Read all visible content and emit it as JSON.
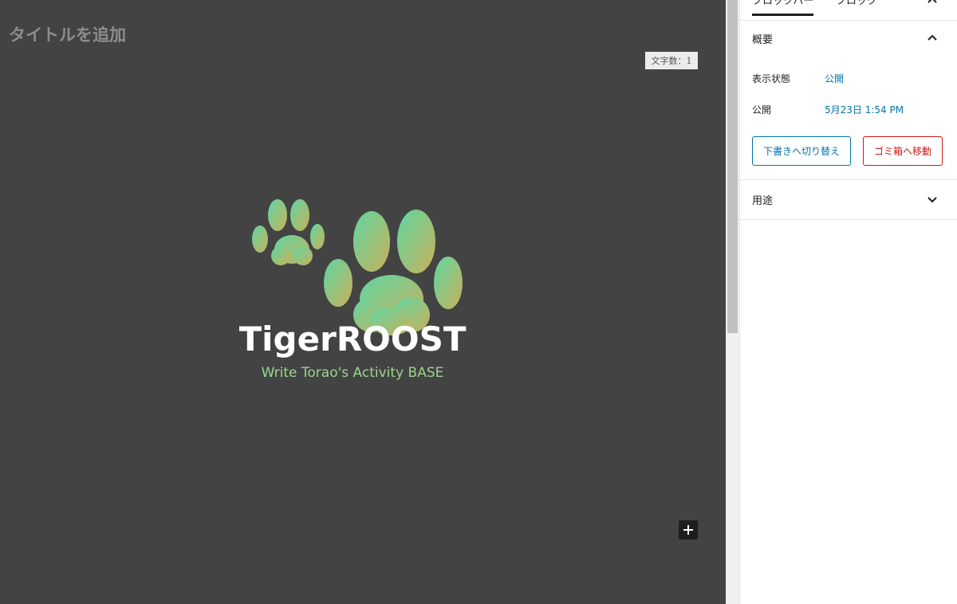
{
  "editor": {
    "title_placeholder": "タイトルを追加",
    "char_count": "文字数：1",
    "logo": {
      "brand_name": "TigerROOST",
      "tagline": "Write Torao's Activity BASE",
      "gradient_start": "#5fd6a2",
      "gradient_end": "#c9b05a",
      "tagline_color": "#9ad68a"
    },
    "add_block_icon": "plus-icon"
  },
  "sidebar": {
    "tabs": [
      {
        "label": "ブロックバー"
      },
      {
        "label": "ブロック"
      }
    ],
    "close_icon": "close-icon",
    "summary": {
      "title": "概要",
      "visibility_label": "表示状態",
      "visibility_value": "公開",
      "publish_label": "公開",
      "publish_value": "5月23日 1:54 PM",
      "draft_button": "下書きへ切り替え",
      "trash_button": "ゴミ箱へ移動"
    },
    "usage_panel": {
      "title": "用途"
    }
  },
  "colors": {
    "editor_bg": "#434343",
    "accent_blue": "#0073aa",
    "danger_red": "#cc1818"
  }
}
